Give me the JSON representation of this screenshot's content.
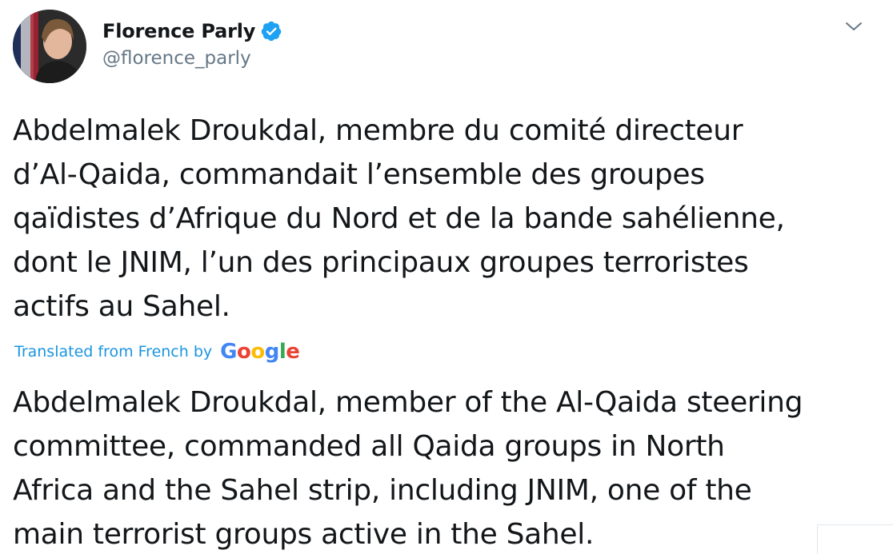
{
  "author": {
    "display_name": "Florence Parly",
    "handle": "@florence_parly",
    "verified": true,
    "avatar_icon": "user-avatar-photo"
  },
  "tweet": {
    "original_lines": [
      "Abdelmalek Droukdal, membre du comité directeur",
      "d’Al-Qaida, commandait l’ensemble des groupes",
      "qaïdistes d’Afrique du Nord et de la bande sahélienne,",
      "dont le JNIM, l’un des principaux groupes terroristes",
      "actifs au Sahel."
    ],
    "translation_label": "Translated from French by",
    "translation_provider": "Google",
    "translated_lines": [
      "Abdelmalek Droukdal, member of the Al-Qaida steering",
      "committee, commanded all Qaida groups in North",
      "Africa and the Sahel strip, including JNIM, one of the",
      "main terrorist groups active in the Sahel."
    ]
  },
  "colors": {
    "text": "#14171a",
    "secondary": "#657786",
    "link": "#1b95e0",
    "verified_badge": "#1da1f2"
  },
  "icons": {
    "verified": "verified-badge-icon",
    "menu": "chevron-down-icon"
  }
}
